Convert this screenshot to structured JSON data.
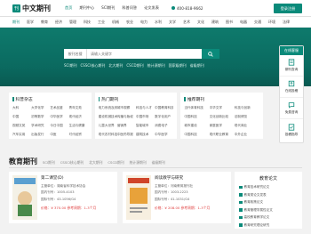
{
  "header": {
    "logo_text": "中文期刊",
    "nav": [
      "首页",
      "期刊中心",
      "SCI期刊",
      "科普问答",
      "论文发表"
    ],
    "phone": "400-818-9662",
    "login_label": "登录注册"
  },
  "categories": [
    "期刊",
    "医学",
    "教育",
    "经济",
    "管理",
    "科技",
    "工业",
    "机械",
    "农业",
    "电力",
    "水利",
    "文学",
    "艺术",
    "文化",
    "建筑",
    "图书",
    "电器",
    "交通",
    "环境",
    "法律"
  ],
  "search": {
    "select_label": "按刊名搜",
    "placeholder": "请输入关键字",
    "hot": [
      "SCI期刊",
      "CSSCI核心期刊",
      "北大期刊",
      "CSCD期刊",
      "统计源期刊",
      "国家级期刊",
      "省级期刊"
    ]
  },
  "sidebar": {
    "title": "在线客服",
    "items": [
      "期刊查询",
      "在线投稿",
      "免费咨询",
      "投稿指导"
    ]
  },
  "panels": [
    {
      "title": "科普杂志",
      "items": [
        "大科",
        "大学化学",
        "艺术品鉴",
        "青年文苑",
        "中国",
        "初等数学",
        "中华医学",
        "现代经济",
        "视频文苑",
        "学术研究",
        "今日中国",
        "生活与健康",
        "汽车实用",
        "出版发行",
        "中医",
        "时代经贸"
      ]
    },
    {
      "title": "热门期刊",
      "items": [
        "电力系统及其",
        "城市观察",
        "科技与人才",
        "中国教育科技",
        "建设机械技术",
        "传播与版权",
        "中国市场",
        "数字化用户",
        "儿童大世界",
        "营销界",
        "智能城市",
        "消费电子",
        "现代农村科技",
        "中医药导报",
        "建筑技术",
        "中华医学"
      ]
    },
    {
      "title": "推荐期刊",
      "items": [
        "当代体育科技",
        "中华文学",
        "科技与创新",
        "中国科技",
        "文化创新比较",
        "法制博览",
        "城市建设",
        "家庭医学",
        "现代商业",
        "中国科技",
        "现代职业教育",
        "中外企业"
      ]
    }
  ],
  "edu": {
    "title": "教育期刊",
    "tabs": [
      "SCI期刊",
      "CSSCI核心期刊",
      "北大期刊",
      "CSCD期刊",
      "统计源期刊",
      "省级期刊"
    ],
    "cards": [
      {
        "title": "第二课堂(D)",
        "lines": [
          "主管单位：湖南省科学技术协会",
          "国内刊号：1005-4103",
          "国际刊号：43-1056/G4"
        ],
        "price": "价格：¥ 370.00  参考周期：1-3个月"
      },
      {
        "title": "阅读教学与研究",
        "lines": [
          "主管单位：河南教育报刊社",
          "国内刊号：1003-2223",
          "国际刊号：41-1031/G4"
        ],
        "price": "价格：¥ 208.00  参考周期：1-3个月"
      }
    ],
    "rank_title": "教育论文",
    "rank": [
      "教育技术研究论文",
      "教育类论文发表",
      "教育政策论文",
      "教育管理学属性论文",
      "高校教育教学论文",
      "教育研究理论研究"
    ]
  }
}
